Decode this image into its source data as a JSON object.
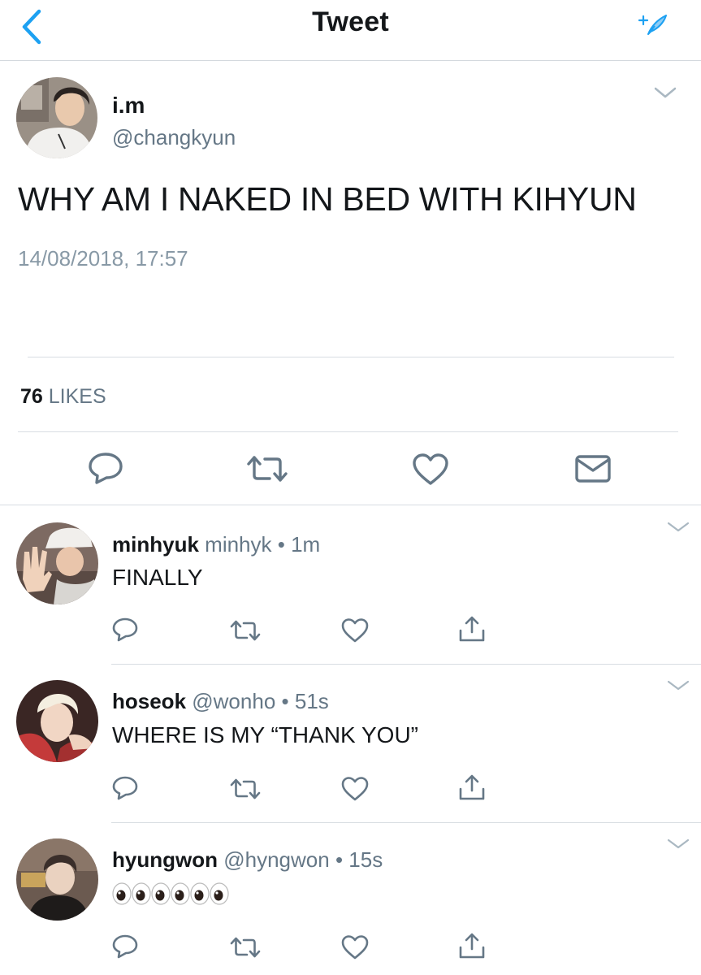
{
  "header": {
    "title": "Tweet",
    "back_icon": "chevron-left-icon",
    "compose_icon": "sparkle-feather-icon",
    "accent": "#1da1f2"
  },
  "main_tweet": {
    "name": "i.m",
    "handle": "@changkyun",
    "text": "WHY AM I NAKED IN BED WITH KIHYUN",
    "timestamp": "14/08/2018, 17:57",
    "likes_count": "76",
    "likes_label": "LIKES"
  },
  "replies": [
    {
      "name": "minhyuk",
      "handle": "minhyk",
      "sep": "•",
      "time": "1m",
      "text": "FINALLY"
    },
    {
      "name": "hoseok",
      "handle": "@wonho",
      "sep": "•",
      "time": "51s",
      "text": "WHERE IS MY “THANK YOU”"
    },
    {
      "name": "hyungwon",
      "handle": "@hyngwon",
      "sep": "•",
      "time": "15s",
      "text": "👀👀👀"
    }
  ],
  "colors": {
    "text": "#14171a",
    "secondary": "#657786",
    "light": "#8899a6",
    "divider": "#d8dde2",
    "icon": "#657786"
  }
}
